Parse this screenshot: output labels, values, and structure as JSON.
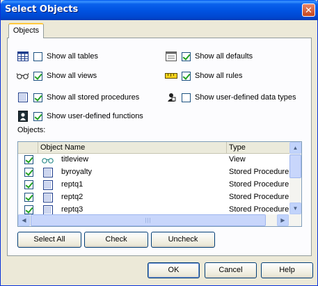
{
  "window": {
    "title": "Select Objects",
    "close_glyph": "✕"
  },
  "tab": {
    "label": "Objects"
  },
  "options": [
    {
      "label": "Show all tables",
      "checked": false,
      "icon": "table-icon"
    },
    {
      "label": "Show all defaults",
      "checked": true,
      "icon": "default-icon"
    },
    {
      "label": "Show all views",
      "checked": true,
      "icon": "glasses-icon"
    },
    {
      "label": "Show all rules",
      "checked": true,
      "icon": "ruler-icon"
    },
    {
      "label": "Show all stored procedures",
      "checked": true,
      "icon": "stored-procedure-icon"
    },
    {
      "label": "Show user-defined data types",
      "checked": false,
      "icon": "udt-icon"
    },
    {
      "label": "Show user-defined functions",
      "checked": true,
      "icon": "function-icon"
    }
  ],
  "objects_label": "Objects:",
  "grid": {
    "columns": [
      "Object Name",
      "Type"
    ],
    "rows": [
      {
        "name": "titleview",
        "type": "View",
        "checked": true,
        "icon": "glasses-icon"
      },
      {
        "name": "byroyalty",
        "type": "Stored Procedure",
        "checked": true,
        "icon": "stored-procedure-icon"
      },
      {
        "name": "reptq1",
        "type": "Stored Procedure",
        "checked": true,
        "icon": "stored-procedure-icon"
      },
      {
        "name": "reptq2",
        "type": "Stored Procedure",
        "checked": true,
        "icon": "stored-procedure-icon"
      },
      {
        "name": "reptq3",
        "type": "Stored Procedure",
        "checked": true,
        "icon": "stored-procedure-icon"
      }
    ]
  },
  "buttons": {
    "select_all": "Select All",
    "check": "Check",
    "uncheck": "Uncheck",
    "ok": "OK",
    "cancel": "Cancel",
    "help": "Help"
  }
}
